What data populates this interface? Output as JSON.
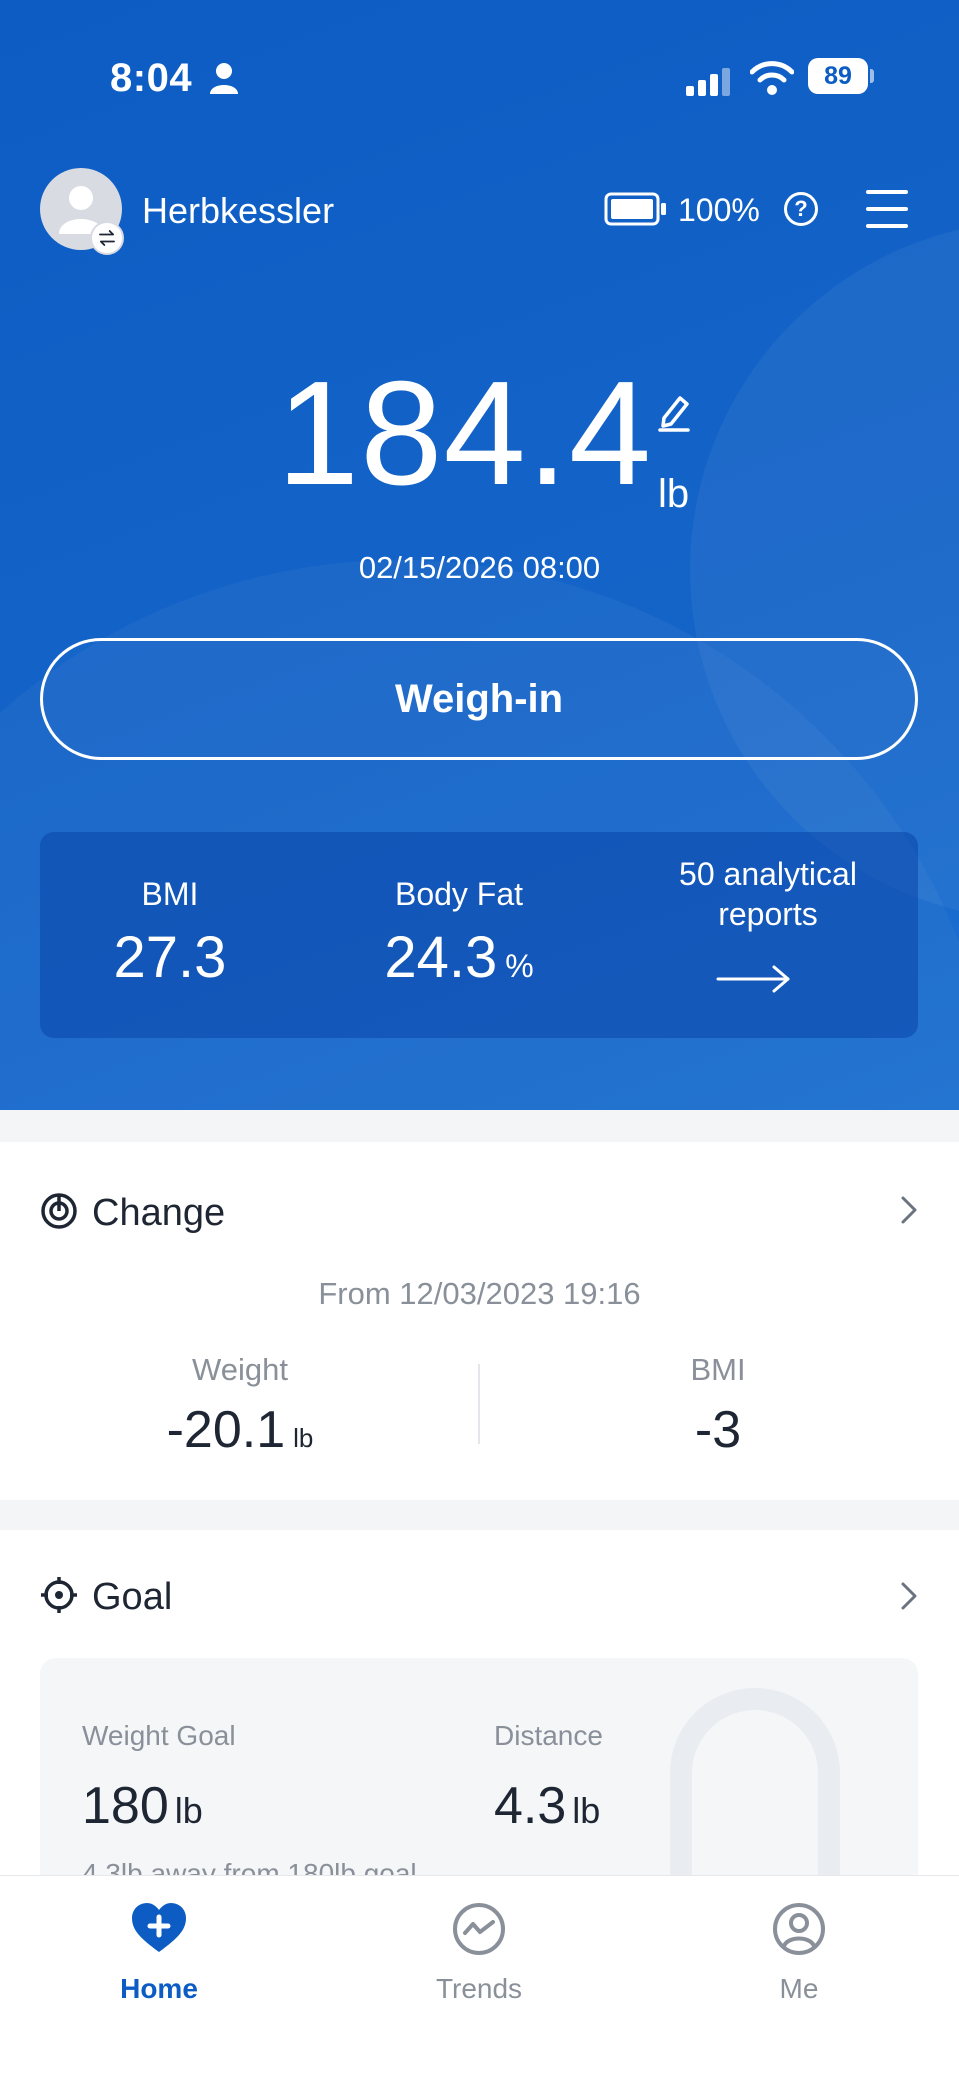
{
  "status_bar": {
    "time": "8:04",
    "battery_level": "89",
    "icons": [
      "person-icon",
      "signal-icon",
      "wifi-icon",
      "battery-icon"
    ]
  },
  "header": {
    "username": "Herbkessler",
    "scale_battery": "100%",
    "icons": [
      "avatar-icon",
      "switch-user-icon",
      "scale-battery-icon",
      "help-icon",
      "menu-icon"
    ]
  },
  "measurement": {
    "weight": "184.4",
    "unit": "lb",
    "datetime": "02/15/2026 08:00",
    "weigh_in_label": "Weigh-in"
  },
  "metrics": {
    "bmi_label": "BMI",
    "bmi_value": "27.3",
    "body_fat_label": "Body Fat",
    "body_fat_value": "24.3",
    "body_fat_unit": "%",
    "reports_label": "50 analytical reports"
  },
  "change": {
    "title": "Change",
    "from": "From 12/03/2023 19:16",
    "weight_label": "Weight",
    "weight_value": "-20.1",
    "weight_unit": "lb",
    "bmi_label": "BMI",
    "bmi_value": "-3"
  },
  "goal": {
    "title": "Goal",
    "weight_goal_label": "Weight Goal",
    "weight_goal_value": "180",
    "weight_goal_unit": "lb",
    "distance_label": "Distance",
    "distance_value": "4.3",
    "distance_unit": "lb",
    "note": "4.3lb away from 180lb goal"
  },
  "tabs": [
    {
      "label": "Home",
      "active": true
    },
    {
      "label": "Trends",
      "active": false
    },
    {
      "label": "Me",
      "active": false
    }
  ],
  "colors": {
    "primary": "#0c5cc4",
    "muted": "#8a9099",
    "text": "#1f2633"
  }
}
